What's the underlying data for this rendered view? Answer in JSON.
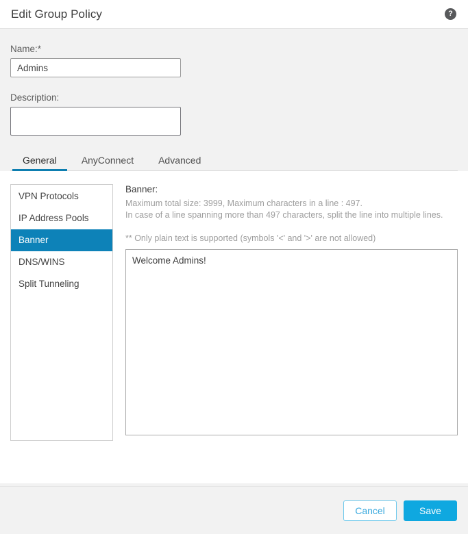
{
  "header": {
    "title": "Edit Group Policy",
    "help_icon": "help-circle-icon",
    "help_glyph": "?"
  },
  "form": {
    "name_label": "Name:*",
    "name_value": "Admins",
    "name_placeholder": "",
    "description_label": "Description:",
    "description_value": "",
    "description_placeholder": ""
  },
  "tabs": [
    {
      "label": "General",
      "active": true
    },
    {
      "label": "AnyConnect",
      "active": false
    },
    {
      "label": "Advanced",
      "active": false
    }
  ],
  "sidebar": {
    "items": [
      {
        "label": "VPN Protocols",
        "selected": false
      },
      {
        "label": "IP Address Pools",
        "selected": false
      },
      {
        "label": "Banner",
        "selected": true
      },
      {
        "label": "DNS/WINS",
        "selected": false
      },
      {
        "label": "Split Tunneling",
        "selected": false
      }
    ]
  },
  "banner": {
    "title": "Banner:",
    "hint_line1": "Maximum total size: 3999, Maximum characters in a line : 497.",
    "hint_line2": "In case of a line spanning more than 497 characters, split the line into multiple lines.",
    "note": "** Only plain text is supported (symbols '<' and '>' are not allowed)",
    "value": "Welcome Admins!",
    "placeholder": ""
  },
  "footer": {
    "cancel_label": "Cancel",
    "save_label": "Save"
  },
  "colors": {
    "accent_blue": "#0d82b8",
    "tab_underline": "#0d7eb0",
    "save_blue": "#0fa8e0",
    "cancel_border": "#6fc9ec",
    "body_gray": "#f2f2f2",
    "hint_gray": "#9d9d9d"
  }
}
